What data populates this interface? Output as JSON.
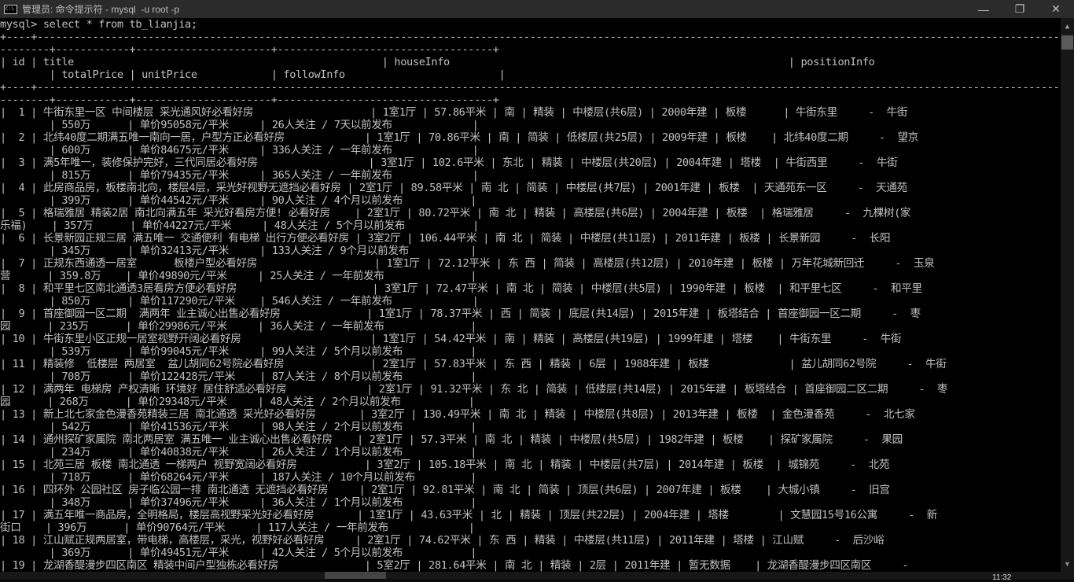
{
  "window": {
    "icon": "cmd-icon",
    "title": "管理员: 命令提示符 - mysql  -u root -p",
    "controls": {
      "minimize": "—",
      "restore": "❐",
      "close": "✕"
    }
  },
  "console": {
    "prompt_line": "mysql> select * from tb_lianjia;",
    "border_a": "+----+--------------------------------------------------------------------------------------------------------------------------------------------------------------------------------------------------------------------------------------------------------------------------------------------------------------------------------------------------------------------------------------------------------+---------------------------------------------------------------------------------------------------------------------------+-------------------------------",
    "border_b": "--------+------------+----------------------+-----------------------------------+",
    "columns": [
      "id",
      "title",
      "houseInfo",
      "positionInfo",
      "totalPrice",
      "unitPrice",
      "followInfo"
    ],
    "header_line1": "| id | title                                                  | houseInfo                                                       | positionInfo",
    "header_line2": "        | totalPrice | unitPrice            | followInfo                         |",
    "rows": [
      {
        "id": "1",
        "title": "牛街东里一区 中间楼层 采光通风好必看好房",
        "houseInfo": "1室1厅 | 57.86平米 | 南 | 精装 | 中楼层(共6层) | 2000年建 | 板楼",
        "positionInfo": "牛街东里    -  牛街",
        "positionWrap": "",
        "totalPrice": "550万",
        "unitPrice": "单价95058元/平米",
        "followInfo": "26人关注 / 7天以前发布",
        "line1": "|  1 | 牛街东里一区 中间楼层 采光通风好必看好房                   | 1室1厅 | 57.86平米 | 南 | 精装 | 中楼层(共6层) | 2000年建 | 板楼      | 牛街东里     -  牛街",
        "line2": "        | 550万      | 单价95058元/平米     | 26人关注 / 7天以前发布             |"
      },
      {
        "id": "2",
        "title": "北纬40度二期满五唯一南向一居，户型方正必看好房",
        "houseInfo": "1室1厅 | 70.86平米 | 南 | 简装 | 低楼层(共25层) | 2009年建 | 板楼",
        "positionInfo": "北纬40度二期    -  望京",
        "positionWrap": "",
        "totalPrice": "600万",
        "unitPrice": "单价84675元/平米",
        "followInfo": "336人关注 / 一年前发布",
        "line1": "|  2 | 北纬40度二期满五唯一南向一居，户型方正必看好房             | 1室1厅 | 70.86平米 | 南 | 简装 | 低楼层(共25层) | 2009年建 | 板楼    | 北纬40度二期     -  望京",
        "line2": "        | 600万      | 单价84675元/平米     | 336人关注 / 一年前发布             |"
      },
      {
        "id": "3",
        "title": "满5年唯一，装修保护完好，三代同居必看好房",
        "houseInfo": "3室1厅 | 102.6平米 | 东北 | 精装 | 中楼层(共20层) | 2004年建 | 塔楼",
        "positionInfo": "牛街西里    -  牛街",
        "positionWrap": "",
        "totalPrice": "815万",
        "unitPrice": "单价79435元/平米",
        "followInfo": "365人关注 / 一年前发布",
        "line1": "|  3 | 满5年唯一，装修保护完好，三代同居必看好房                  | 3室1厅 | 102.6平米 | 东北 | 精装 | 中楼层(共20层) | 2004年建 | 塔楼  | 牛街西里     -  牛街",
        "line2": "        | 815万      | 单价79435元/平米     | 365人关注 / 一年前发布             |"
      },
      {
        "id": "4",
        "title": "此房商品房，板楼南北向，楼层4层，采光好视野无遮挡必看好房",
        "houseInfo": "2室1厅 | 89.58平米 | 南 北 | 简装 | 中楼层(共7层) | 2001年建 | 板楼",
        "positionInfo": "天通苑东一区    -  天通苑",
        "positionWrap": "",
        "totalPrice": "399万",
        "unitPrice": "单价44542元/平米",
        "followInfo": "90人关注 / 4个月以前发布",
        "line1": "|  4 | 此房商品房，板楼南北向，楼层4层，采光好视野无遮挡必看好房 | 2室1厅 | 89.58平米 | 南 北 | 简装 | 中楼层(共7层) | 2001年建 | 板楼  | 天通苑东一区     -  天通苑",
        "line2": "        | 399万      | 单价44542元/平米     | 90人关注 / 4个月以前发布           |"
      },
      {
        "id": "5",
        "title": "格瑞雅居 精装2居 南北向满五年 采光好看房方便! 必看好房",
        "houseInfo": "2室1厅 | 80.72平米 | 南 北 | 精装 | 高楼层(共6层) | 2004年建 | 板楼",
        "positionInfo": "格瑞雅居    -  九棵树(家乐福)",
        "positionWrap": "乐福)",
        "totalPrice": "357万",
        "unitPrice": "单价44227元/平米",
        "followInfo": "48人关注 / 5个月以前发布",
        "line1": "|  5 | 格瑞雅居 精装2居 南北向满五年 采光好看房方便! 必看好房    | 2室1厅 | 80.72平米 | 南 北 | 精装 | 高楼层(共6层) | 2004年建 | 板楼  | 格瑞雅居     -  九棵树(家",
        "line2": "乐福)    | 357万      | 单价44227元/平米     | 48人关注 / 5个月以前发布           |"
      },
      {
        "id": "6",
        "title": "长景新园正规三居 满五唯一 交通便利 有电梯 出行方便必看好房",
        "houseInfo": "3室2厅 | 106.44平米 | 南 北 | 简装 | 中楼层(共11层) | 2011年建 | 板楼",
        "positionInfo": "长景新园    -  长阳",
        "positionWrap": "",
        "totalPrice": "345万",
        "unitPrice": "单价32413元/平米",
        "followInfo": "133人关注 / 9个月以前发布",
        "line1": "|  6 | 长景新园正规三居 满五唯一 交通便利 有电梯 出行方便必看好房 | 3室2厅 | 106.44平米 | 南 北 | 简装 | 中楼层(共11层) | 2011年建 | 板楼 | 长景新园     -  长阳",
        "line2": "        | 345万      | 单价32413元/平米     | 133人关注 / 9个月以前发布          |"
      },
      {
        "id": "7",
        "title": "正规东西通透一居室      板楼户型必看好房",
        "houseInfo": "1室1厅 | 72.12平米 | 东 西 | 简装 | 高楼层(共12层) | 2010年建 | 板楼",
        "positionInfo": "万年花城新回迁    -  玉泉营",
        "positionWrap": "营",
        "totalPrice": "359.8万",
        "unitPrice": "单价49890元/平米",
        "followInfo": "25人关注 / 一年前发布",
        "line1": "|  7 | 正规东西通透一居室      板楼户型必看好房                   | 1室1厅 | 72.12平米 | 东 西 | 简装 | 高楼层(共12层) | 2010年建 | 板楼 | 万年花城新回迁     -  玉泉",
        "line2": "营      | 359.8万    | 单价49890元/平米     | 25人关注 / 一年前发布              |"
      },
      {
        "id": "8",
        "title": "和平里七区南北通透3居看房方便必看好房",
        "houseInfo": "3室1厅 | 72.47平米 | 南 北 | 简装 | 中楼层(共5层) | 1990年建 | 板楼",
        "positionInfo": "和平里七区    -  和平里",
        "positionWrap": "",
        "totalPrice": "850万",
        "unitPrice": "单价117290元/平米",
        "followInfo": "546人关注 / 一年前发布",
        "line1": "|  8 | 和平里七区南北通透3居看房方便必看好房                      | 3室1厅 | 72.47平米 | 南 北 | 简装 | 中楼层(共5层) | 1990年建 | 板楼  | 和平里七区     -  和平里",
        "line2": "        | 850万      | 单价117290元/平米    | 546人关注 / 一年前发布             |"
      },
      {
        "id": "9",
        "title": "首座御园一区二期  满两年 业主诚心出售必看好房",
        "houseInfo": "1室1厅 | 78.37平米 | 西 | 简装 | 底层(共14层) | 2015年建 | 板塔结合",
        "positionInfo": "首座御园一区二期    -  枣园",
        "positionWrap": "园",
        "totalPrice": "235万",
        "unitPrice": "单价29986元/平米",
        "followInfo": "36人关注 / 一年前发布",
        "line1": "|  9 | 首座御园一区二期  满两年 业主诚心出售必看好房              | 1室1厅 | 78.37平米 | 西 | 简装 | 底层(共14层) | 2015年建 | 板塔结合 | 首座御园一区二期     -  枣",
        "line2": "园      | 235万      | 单价29986元/平米     | 36人关注 / 一年前发布              |"
      },
      {
        "id": "10",
        "title": "牛街东里小区正规一居室视野开阔必看好房",
        "houseInfo": "1室1厅 | 54.42平米 | 南 | 精装 | 高楼层(共19层) | 1999年建 | 塔楼",
        "positionInfo": "牛街东里    -  牛街",
        "positionWrap": "",
        "totalPrice": "539万",
        "unitPrice": "单价99045元/平米",
        "followInfo": "99人关注 / 5个月以前发布",
        "line1": "| 10 | 牛街东里小区正规一居室视野开阔必看好房                     | 1室1厅 | 54.42平米 | 南 | 精装 | 高楼层(共19层) | 1999年建 | 塔楼    | 牛街东里     -  牛街",
        "line2": "        | 539万      | 单价99045元/平米     | 99人关注 / 5个月以前发布           |"
      },
      {
        "id": "11",
        "title": "精装修  低楼层 两居室  盆儿胡同62号院必看好房",
        "houseInfo": "2室1厅 | 57.83平米 | 东 西 | 精装 | 6层 | 1988年建 | 板楼",
        "positionInfo": "盆儿胡同62号院    -  牛街",
        "positionWrap": "",
        "totalPrice": "708万",
        "unitPrice": "单价122428元/平米",
        "followInfo": "87人关注 / 8个月以前发布",
        "line1": "| 11 | 精装修  低楼层 两居室  盆儿胡同62号院必看好房              | 2室1厅 | 57.83平米 | 东 西 | 精装 | 6层 | 1988年建 | 板楼             | 盆儿胡同62号院     -  牛街",
        "line2": "        | 708万      | 单价122428元/平米    | 87人关注 / 8个月以前发布           |"
      },
      {
        "id": "12",
        "title": "满两年 电梯房 产权清晰 环境好 居住舒适必看好房",
        "houseInfo": "2室1厅 | 91.32平米 | 东 北 | 简装 | 低楼层(共14层) | 2015年建 | 板塔结合",
        "positionInfo": "首座御园二区二期    -  枣园",
        "positionWrap": "园",
        "totalPrice": "268万",
        "unitPrice": "单价29348元/平米",
        "followInfo": "48人关注 / 2个月以前发布",
        "line1": "| 12 | 满两年 电梯房 产权清晰 环境好 居住舒适必看好房             | 2室1厅 | 91.32平米 | 东 北 | 简装 | 低楼层(共14层) | 2015年建 | 板塔结合 | 首座御园二区二期     -  枣",
        "line2": "园      | 268万      | 单价29348元/平米     | 48人关注 / 2个月以前发布           |"
      },
      {
        "id": "13",
        "title": "新上北七家金色漫香苑精装三居 南北通透 采光好必看好房",
        "houseInfo": "3室2厅 | 130.49平米 | 南 北 | 精装 | 中楼层(共8层) | 2013年建 | 板楼",
        "positionInfo": "金色漫香苑    -  北七家",
        "positionWrap": "",
        "totalPrice": "542万",
        "unitPrice": "单价41536元/平米",
        "followInfo": "98人关注 / 2个月以前发布",
        "line1": "| 13 | 新上北七家金色漫香苑精装三居 南北通透 采光好必看好房       | 3室2厅 | 130.49平米 | 南 北 | 精装 | 中楼层(共8层) | 2013年建 | 板楼  | 金色漫香苑     -  北七家",
        "line2": "        | 542万      | 单价41536元/平米     | 98人关注 / 2个月以前发布           |"
      },
      {
        "id": "14",
        "title": "通州探矿家属院 南北两居室 满五唯一 业主诚心出售必看好房",
        "houseInfo": "2室1厅 | 57.3平米 | 南 北 | 精装 | 中楼层(共5层) | 1982年建 | 板楼",
        "positionInfo": "探矿家属院    -  果园",
        "positionWrap": "",
        "totalPrice": "234万",
        "unitPrice": "单价40838元/平米",
        "followInfo": "26人关注 / 1个月以前发布",
        "line1": "| 14 | 通州探矿家属院 南北两居室 满五唯一 业主诚心出售必看好房    | 2室1厅 | 57.3平米 | 南 北 | 精装 | 中楼层(共5层) | 1982年建 | 板楼    | 探矿家属院     -  果园",
        "line2": "        | 234万      | 单价40838元/平米     | 26人关注 / 1个月以前发布           |"
      },
      {
        "id": "15",
        "title": "北苑三居 板楼 南北通透 一梯两户 视野宽阔必看好房",
        "houseInfo": "3室2厅 | 105.18平米 | 南 北 | 精装 | 中楼层(共7层) | 2014年建 | 板楼",
        "positionInfo": "城锦苑    -  北苑",
        "positionWrap": "",
        "totalPrice": "718万",
        "unitPrice": "单价68264元/平米",
        "followInfo": "187人关注 / 10个月以前发布",
        "line1": "| 15 | 北苑三居 板楼 南北通透 一梯两户 视野宽阔必看好房           | 3室2厅 | 105.18平米 | 南 北 | 精装 | 中楼层(共7层) | 2014年建 | 板楼  | 城锦苑     -  北苑",
        "line2": "        | 718万      | 单价68264元/平米     | 187人关注 / 10个月以前发布         |"
      },
      {
        "id": "16",
        "title": "四环外 公园社区 房子临公园一排 南北通透 无遮挡必看好房",
        "houseInfo": "2室1厅 | 92.81平米 | 南 北 | 简装 | 顶层(共6层) | 2007年建 | 板楼",
        "positionInfo": "大城小镇    -  旧宫",
        "positionWrap": "",
        "totalPrice": "348万",
        "unitPrice": "单价37496元/平米",
        "followInfo": "36人关注 / 1个月以前发布",
        "line1": "| 16 | 四环外 公园社区 房子临公园一排 南北通透 无遮挡必看好房     | 2室1厅 | 92.81平米 | 南 北 | 简装 | 顶层(共6层) | 2007年建 | 板楼    | 大城小镇     -  旧宫",
        "line2": "        | 348万      | 单价37496元/平米     | 36人关注 / 1个月以前发布           |"
      },
      {
        "id": "17",
        "title": "满五年唯一商品房，全明格局，楼层高视野采光好必看好房",
        "houseInfo": "1室1厅 | 43.63平米 | 北 | 精装 | 顶层(共22层) | 2004年建 | 塔楼",
        "positionInfo": "文慧园15号16公寓    -  新街口",
        "positionWrap": "街口",
        "totalPrice": "396万",
        "unitPrice": "单价90764元/平米",
        "followInfo": "117人关注 / 一年前发布",
        "line1": "| 17 | 满五年唯一商品房，全明格局，楼层高视野采光好必看好房       | 1室1厅 | 43.63平米 | 北 | 精装 | 顶层(共22层) | 2004年建 | 塔楼        | 文慧园15号16公寓     -  新",
        "line2": "街口    | 396万      | 单价90764元/平米     | 117人关注 / 一年前发布             |"
      },
      {
        "id": "18",
        "title": "江山赋正规两居室，带电梯，高楼层，采光，视野好必看好房",
        "houseInfo": "2室1厅 | 74.62平米 | 东 西 | 精装 | 中楼层(共11层) | 2011年建 | 塔楼",
        "positionInfo": "江山赋    -  后沙峪",
        "positionWrap": "",
        "totalPrice": "369万",
        "unitPrice": "单价49451元/平米",
        "followInfo": "42人关注 / 5个月以前发布",
        "line1": "| 18 | 江山赋正规两居室，带电梯，高楼层，采光，视野好必看好房     | 2室1厅 | 74.62平米 | 东 西 | 精装 | 中楼层(共11层) | 2011年建 | 塔楼 | 江山赋     -  后沙峪",
        "line2": "        | 369万      | 单价49451元/平米     | 42人关注 / 5个月以前发布           |"
      },
      {
        "id": "19",
        "title": "龙湖香醍漫步四区南区 精装中间户型独栋必看好房",
        "houseInfo": "5室2厅 | 281.64平米 | 南 北 | 精装 | 2层 | 2011年建 | 暂无数据",
        "positionInfo": "龙湖香醍漫步四区南区    -",
        "positionWrap": "",
        "totalPrice": "",
        "unitPrice": "",
        "followInfo": "",
        "line1": "| 19 | 龙湖香醍漫步四区南区 精装中间户型独栋必看好房              | 5室2厅 | 281.64平米 | 南 北 | 精装 | 2层 | 2011年建 | 暂无数据    | 龙湖香醍漫步四区南区     -",
        "line2": ""
      }
    ]
  },
  "taskbar": {
    "clock_partial": "11:32"
  }
}
